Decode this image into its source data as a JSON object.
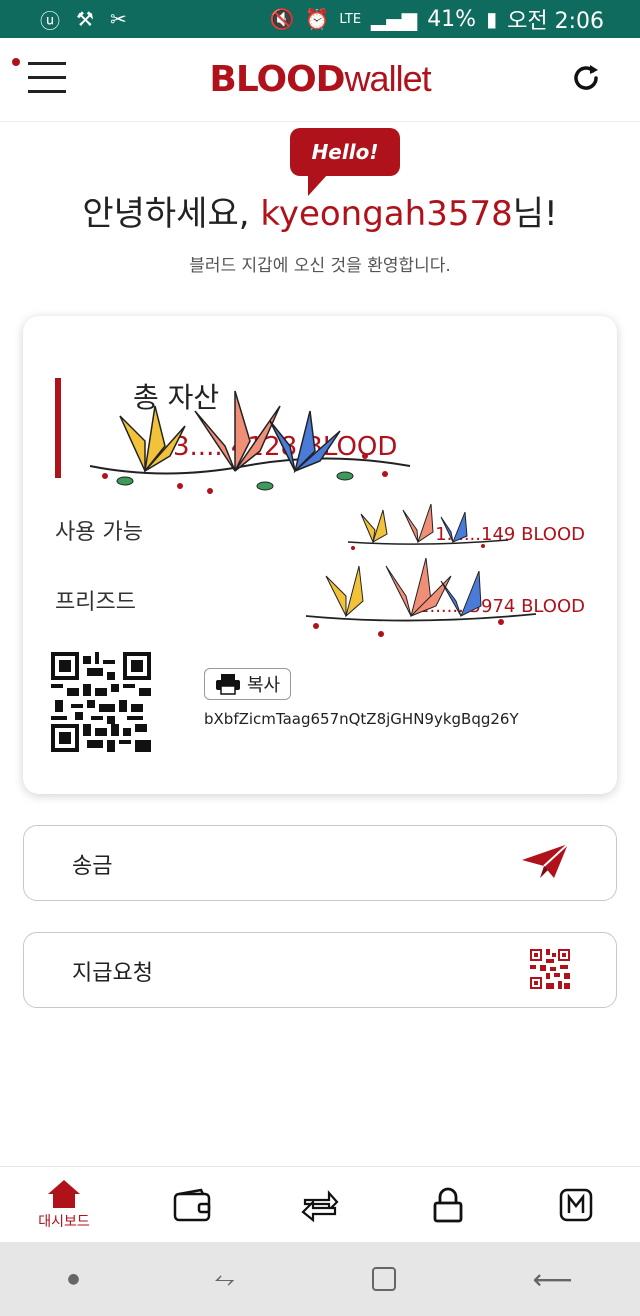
{
  "status_bar": {
    "battery": "41%",
    "time": "오전 2:06",
    "network": "LTE"
  },
  "app": {
    "logo_blood": "BLOOD",
    "logo_wallet": "wallet"
  },
  "greeting": {
    "bubble": "Hello!",
    "prefix": "안녕하세요, ",
    "username": "kyeongah3578",
    "suffix": "님!",
    "subtitle": "블러드 지갑에 오신 것을 환영합니다."
  },
  "balance_card": {
    "total_label": "총 자산",
    "total_value": "3.....4128",
    "total_unit": "BLOOD",
    "available_label": "사용 가능",
    "available_value": "1......149 BLOOD",
    "frozen_label": "프리즈드",
    "frozen_value": "2.......5974 BLOOD",
    "copy_label": "복사",
    "address": "bXbfZicmTaag657nQtZ8jGHN9ykgBqg26Y"
  },
  "actions": {
    "send_label": "송금",
    "request_label": "지급요청"
  },
  "bottom_nav": {
    "dashboard_label": "대시보드"
  },
  "colors": {
    "accent": "#b0121b",
    "status_bar": "#0f6b5e"
  },
  "icons": [
    "menu-icon",
    "refresh-icon",
    "print-icon",
    "send-plane-icon",
    "qr-code-icon",
    "home-icon",
    "wallet-icon",
    "exchange-icon",
    "lock-icon",
    "m-icon"
  ]
}
